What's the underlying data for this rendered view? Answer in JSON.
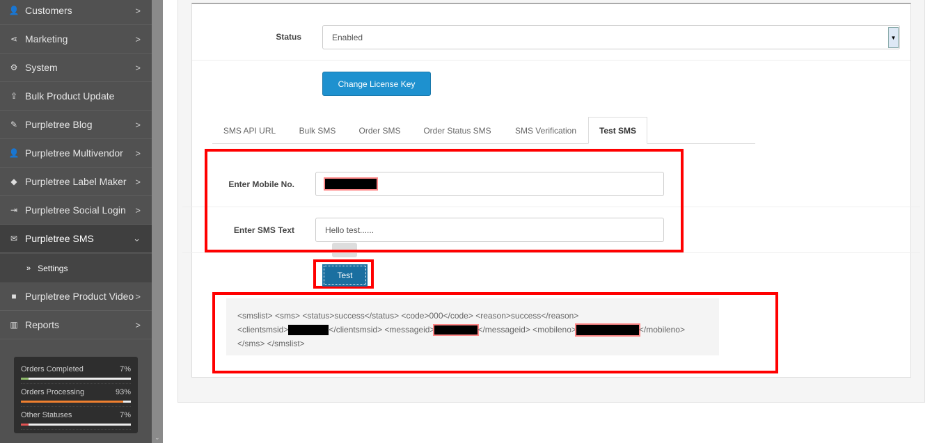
{
  "sidebar": {
    "items": [
      {
        "label": "Customers",
        "icon": "user-icon",
        "chevron": ">"
      },
      {
        "label": "Marketing",
        "icon": "share-icon",
        "chevron": ">"
      },
      {
        "label": "System",
        "icon": "gear-icon",
        "chevron": ">"
      },
      {
        "label": "Bulk Product Update",
        "icon": "upload-icon",
        "chevron": ""
      },
      {
        "label": "Purpletree Blog",
        "icon": "edit-icon",
        "chevron": ">"
      },
      {
        "label": "Purpletree Multivendor",
        "icon": "user-icon",
        "chevron": ">"
      },
      {
        "label": "Purpletree Label Maker",
        "icon": "tag-icon",
        "chevron": ">"
      },
      {
        "label": "Purpletree Social Login",
        "icon": "sign-in-icon",
        "chevron": ">"
      },
      {
        "label": "Purpletree SMS",
        "icon": "envelope-icon",
        "chevron": "⌄"
      }
    ],
    "sub_item": "Settings",
    "after_items": [
      {
        "label": "Purpletree Product Video",
        "icon": "video-icon",
        "chevron": ">"
      },
      {
        "label": "Reports",
        "icon": "bar-chart-icon",
        "chevron": ">"
      }
    ],
    "stats": [
      {
        "label": "Orders Completed",
        "pct": "7%",
        "value": 7,
        "color": "#8fbb6c"
      },
      {
        "label": "Orders Processing",
        "pct": "93%",
        "value": 93,
        "color": "#f0802f"
      },
      {
        "label": "Other Statuses",
        "pct": "7%",
        "value": 7,
        "color": "#e05252"
      }
    ]
  },
  "form": {
    "status_label": "Status",
    "status_value": "Enabled",
    "license_button": "Change License Key",
    "tabs": [
      "SMS API URL",
      "Bulk SMS",
      "Order SMS",
      "Order Status SMS",
      "SMS Verification",
      "Test SMS"
    ],
    "active_tab": "Test SMS",
    "mobile_label": "Enter Mobile No.",
    "sms_text_label": "Enter SMS Text",
    "sms_text_value": "Hello test......",
    "test_button": "Test",
    "response": {
      "line1": "<smslist> <sms> <status>success</status> <code>000</code> <reason>success</reason>",
      "l2a": "<clientsmsid>",
      "l2b": "</clientsmsid> <messageid>",
      "l2c": "</messageid> <mobileno>",
      "l2d": "</mobileno>",
      "line3": "</sms> </smslist>"
    }
  },
  "colors": {
    "primary": "#1e91cf",
    "highlight": "#ff0000"
  }
}
